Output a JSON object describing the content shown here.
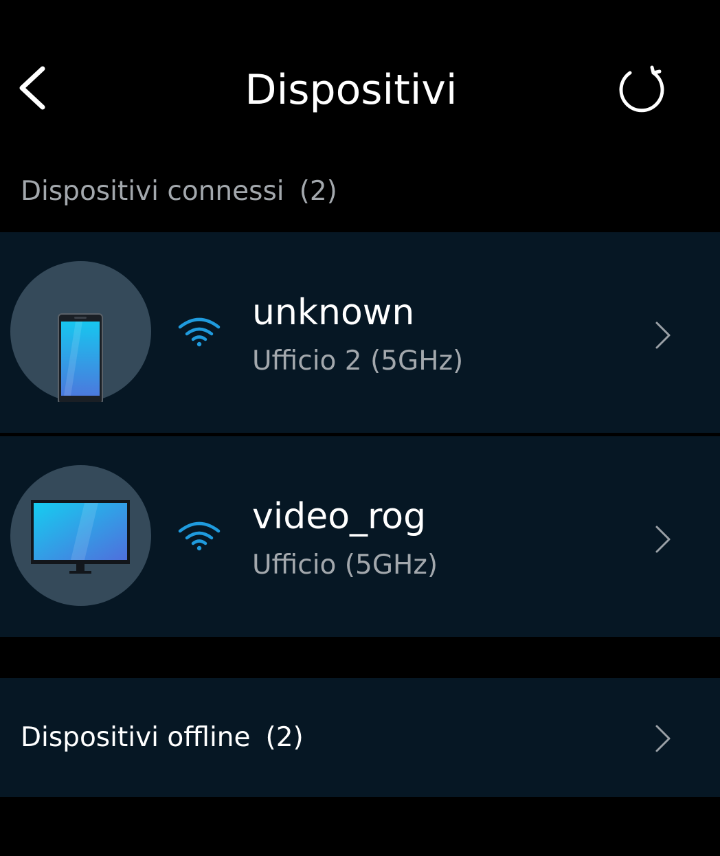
{
  "header": {
    "title": "Dispositivi",
    "back_icon": "chevron-left-icon",
    "refresh_icon": "refresh-icon"
  },
  "connected": {
    "label": "Dispositivi connessi",
    "count": "(2)",
    "devices": [
      {
        "name": "unknown",
        "location": "Ufficio 2 (5GHz)",
        "icon": "smartphone-icon",
        "connection": "wifi-icon"
      },
      {
        "name": "video_rog",
        "location": "Ufficio (5GHz)",
        "icon": "monitor-icon",
        "connection": "wifi-icon"
      }
    ]
  },
  "offline": {
    "label": "Dispositivi offline",
    "count": "(2)"
  },
  "colors": {
    "background": "#000000",
    "row_background": "#061724",
    "avatar_background": "#354a5a",
    "wifi_accent": "#1f9bde",
    "secondary_text": "#a3a8ad"
  }
}
